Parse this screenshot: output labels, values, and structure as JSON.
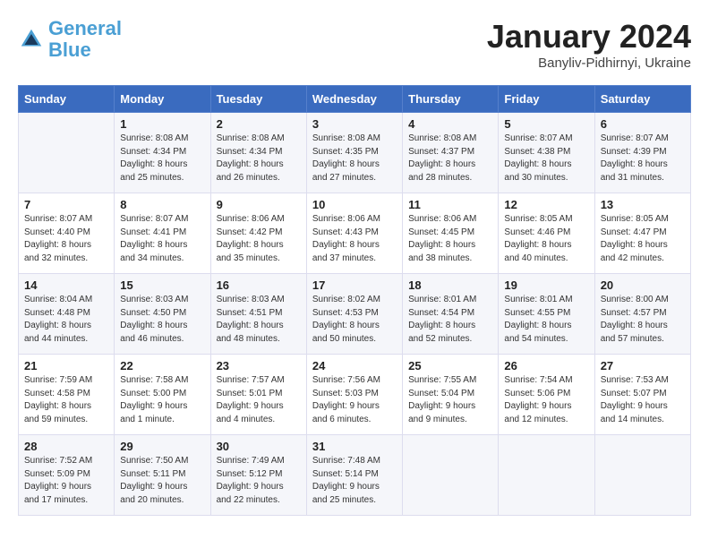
{
  "header": {
    "logo_line1": "General",
    "logo_line2": "Blue",
    "month_title": "January 2024",
    "subtitle": "Banyliv-Pidhirnyi, Ukraine"
  },
  "days_of_week": [
    "Sunday",
    "Monday",
    "Tuesday",
    "Wednesday",
    "Thursday",
    "Friday",
    "Saturday"
  ],
  "weeks": [
    [
      {
        "day": "",
        "info": ""
      },
      {
        "day": "1",
        "info": "Sunrise: 8:08 AM\nSunset: 4:34 PM\nDaylight: 8 hours\nand 25 minutes."
      },
      {
        "day": "2",
        "info": "Sunrise: 8:08 AM\nSunset: 4:34 PM\nDaylight: 8 hours\nand 26 minutes."
      },
      {
        "day": "3",
        "info": "Sunrise: 8:08 AM\nSunset: 4:35 PM\nDaylight: 8 hours\nand 27 minutes."
      },
      {
        "day": "4",
        "info": "Sunrise: 8:08 AM\nSunset: 4:37 PM\nDaylight: 8 hours\nand 28 minutes."
      },
      {
        "day": "5",
        "info": "Sunrise: 8:07 AM\nSunset: 4:38 PM\nDaylight: 8 hours\nand 30 minutes."
      },
      {
        "day": "6",
        "info": "Sunrise: 8:07 AM\nSunset: 4:39 PM\nDaylight: 8 hours\nand 31 minutes."
      }
    ],
    [
      {
        "day": "7",
        "info": "Sunrise: 8:07 AM\nSunset: 4:40 PM\nDaylight: 8 hours\nand 32 minutes."
      },
      {
        "day": "8",
        "info": "Sunrise: 8:07 AM\nSunset: 4:41 PM\nDaylight: 8 hours\nand 34 minutes."
      },
      {
        "day": "9",
        "info": "Sunrise: 8:06 AM\nSunset: 4:42 PM\nDaylight: 8 hours\nand 35 minutes."
      },
      {
        "day": "10",
        "info": "Sunrise: 8:06 AM\nSunset: 4:43 PM\nDaylight: 8 hours\nand 37 minutes."
      },
      {
        "day": "11",
        "info": "Sunrise: 8:06 AM\nSunset: 4:45 PM\nDaylight: 8 hours\nand 38 minutes."
      },
      {
        "day": "12",
        "info": "Sunrise: 8:05 AM\nSunset: 4:46 PM\nDaylight: 8 hours\nand 40 minutes."
      },
      {
        "day": "13",
        "info": "Sunrise: 8:05 AM\nSunset: 4:47 PM\nDaylight: 8 hours\nand 42 minutes."
      }
    ],
    [
      {
        "day": "14",
        "info": "Sunrise: 8:04 AM\nSunset: 4:48 PM\nDaylight: 8 hours\nand 44 minutes."
      },
      {
        "day": "15",
        "info": "Sunrise: 8:03 AM\nSunset: 4:50 PM\nDaylight: 8 hours\nand 46 minutes."
      },
      {
        "day": "16",
        "info": "Sunrise: 8:03 AM\nSunset: 4:51 PM\nDaylight: 8 hours\nand 48 minutes."
      },
      {
        "day": "17",
        "info": "Sunrise: 8:02 AM\nSunset: 4:53 PM\nDaylight: 8 hours\nand 50 minutes."
      },
      {
        "day": "18",
        "info": "Sunrise: 8:01 AM\nSunset: 4:54 PM\nDaylight: 8 hours\nand 52 minutes."
      },
      {
        "day": "19",
        "info": "Sunrise: 8:01 AM\nSunset: 4:55 PM\nDaylight: 8 hours\nand 54 minutes."
      },
      {
        "day": "20",
        "info": "Sunrise: 8:00 AM\nSunset: 4:57 PM\nDaylight: 8 hours\nand 57 minutes."
      }
    ],
    [
      {
        "day": "21",
        "info": "Sunrise: 7:59 AM\nSunset: 4:58 PM\nDaylight: 8 hours\nand 59 minutes."
      },
      {
        "day": "22",
        "info": "Sunrise: 7:58 AM\nSunset: 5:00 PM\nDaylight: 9 hours\nand 1 minute."
      },
      {
        "day": "23",
        "info": "Sunrise: 7:57 AM\nSunset: 5:01 PM\nDaylight: 9 hours\nand 4 minutes."
      },
      {
        "day": "24",
        "info": "Sunrise: 7:56 AM\nSunset: 5:03 PM\nDaylight: 9 hours\nand 6 minutes."
      },
      {
        "day": "25",
        "info": "Sunrise: 7:55 AM\nSunset: 5:04 PM\nDaylight: 9 hours\nand 9 minutes."
      },
      {
        "day": "26",
        "info": "Sunrise: 7:54 AM\nSunset: 5:06 PM\nDaylight: 9 hours\nand 12 minutes."
      },
      {
        "day": "27",
        "info": "Sunrise: 7:53 AM\nSunset: 5:07 PM\nDaylight: 9 hours\nand 14 minutes."
      }
    ],
    [
      {
        "day": "28",
        "info": "Sunrise: 7:52 AM\nSunset: 5:09 PM\nDaylight: 9 hours\nand 17 minutes."
      },
      {
        "day": "29",
        "info": "Sunrise: 7:50 AM\nSunset: 5:11 PM\nDaylight: 9 hours\nand 20 minutes."
      },
      {
        "day": "30",
        "info": "Sunrise: 7:49 AM\nSunset: 5:12 PM\nDaylight: 9 hours\nand 22 minutes."
      },
      {
        "day": "31",
        "info": "Sunrise: 7:48 AM\nSunset: 5:14 PM\nDaylight: 9 hours\nand 25 minutes."
      },
      {
        "day": "",
        "info": ""
      },
      {
        "day": "",
        "info": ""
      },
      {
        "day": "",
        "info": ""
      }
    ]
  ]
}
